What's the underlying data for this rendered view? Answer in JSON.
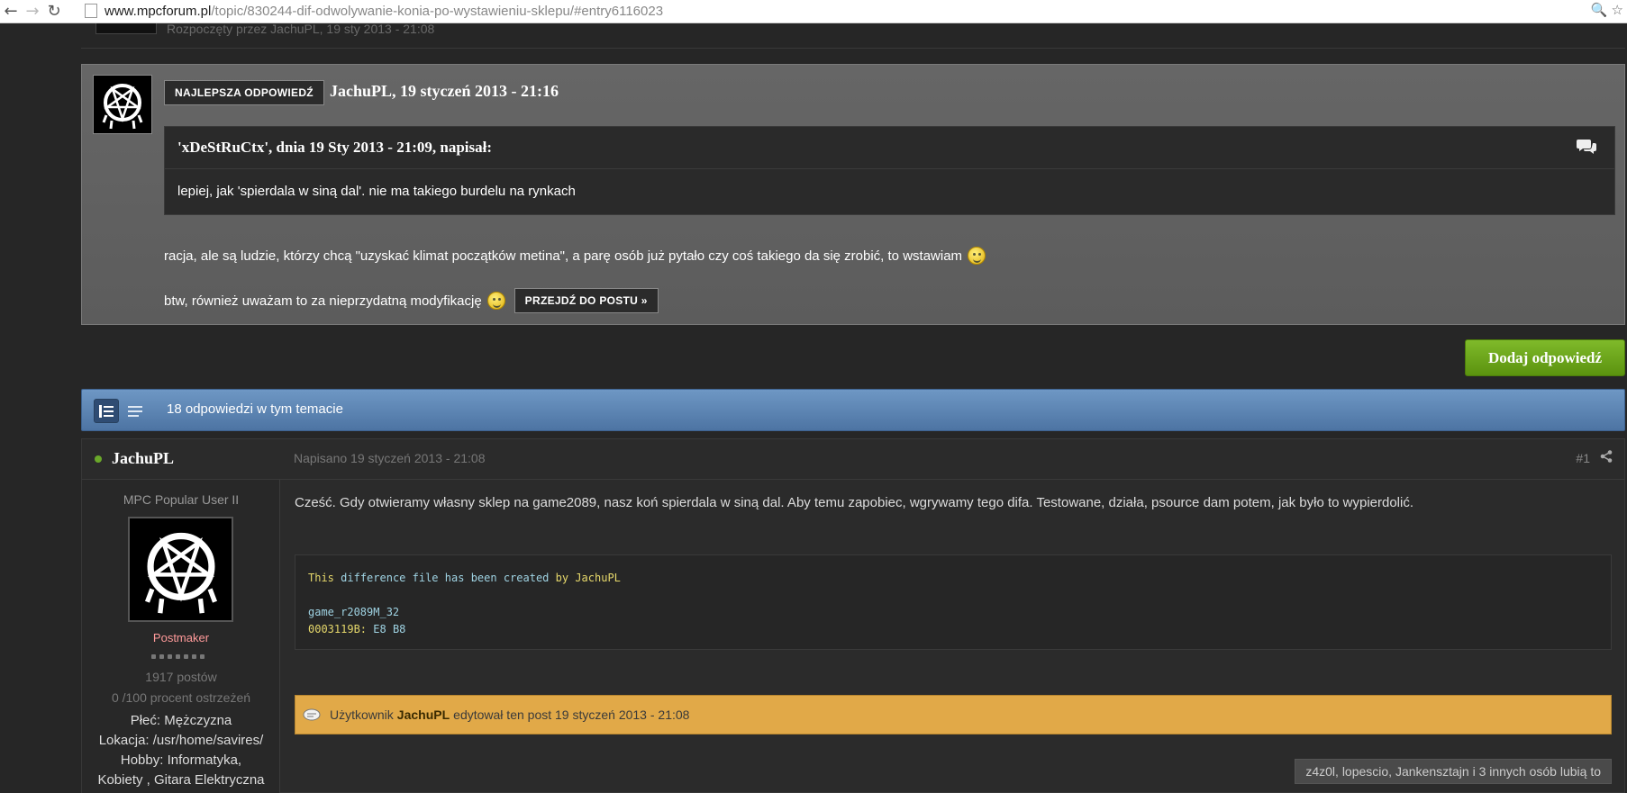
{
  "browser": {
    "back_label": "←",
    "forward_label": "→",
    "reload_label": "↻",
    "url_host": "www.mpcforum.pl",
    "url_path": "/topic/830244-dif-odwolywanie-konia-po-wystawieniu-sklepu/#entry6116023",
    "zoom_icon": "🔍",
    "star_icon": "☆"
  },
  "top_strip": {
    "started_by": "Rozpoczęty przez JachuPL, 19 sty 2013 - 21:08"
  },
  "best_answer": {
    "badge": "NAJLEPSZA ODPOWIEDŹ",
    "author_date": "JachuPL, 19 styczeń 2013 - 21:16",
    "quote_header": "'xDeStRuCtx', dnia 19 Sty 2013 - 21:09, napisał:",
    "quote_body": "lepiej, jak 'spierdala w siną dal'. nie ma takiego burdelu na rynkach",
    "line1": "racja, ale są ludzie, którzy chcą \"uzyskać klimat początków metina\", a parę osób już pytało czy coś takiego da się zrobić, to wstawiam",
    "line2": "btw, również uważam to za nieprzydatną modyfikację",
    "goto_button": "PRZEJDŹ DO POSTU »"
  },
  "reply_button": "Dodaj odpowiedź",
  "topic_bar": {
    "count_text": "18 odpowiedzi w tym temacie"
  },
  "post": {
    "author": "JachuPL",
    "date": "Napisano 19 styczeń 2013 - 21:08",
    "number": "#1",
    "user": {
      "title": "MPC Popular User II",
      "rank": "Postmaker",
      "posts": "1917 postów",
      "warnings": "0 /100 procent ostrzeżeń",
      "gender": "Płeć: Mężczyzna",
      "location": "Lokacja: /usr/home/savires/",
      "hobby": "Hobby: Informatyka,",
      "hobby2": "Kobiety , Gitara Elektryczna"
    },
    "text": "Cześć. Gdy otwieramy własny sklep na game2089, nasz koń spierdala w siną dal. Aby temu zapobiec, wgrywamy tego difa. Testowane, działa, psource dam potem, jak było to wypierdolić.",
    "code": {
      "line1_a": "This",
      "line1_b": "difference",
      "line1_c": "file",
      "line1_d": "has",
      "line1_e": "been",
      "line1_f": "created",
      "line1_g": "by",
      "line1_h": "JachuPL",
      "line2": "game_r2089M_32",
      "line3_addr": "0003119B:",
      "line3_val": "E8 B8"
    },
    "edit": {
      "prefix": "Użytkownik",
      "user": "JachuPL",
      "suffix": "edytował ten post 19 styczeń 2013 - 21:08"
    },
    "likes": "z4z0l, lopescio, Jankensztajn i 3 innych osób lubią to"
  }
}
